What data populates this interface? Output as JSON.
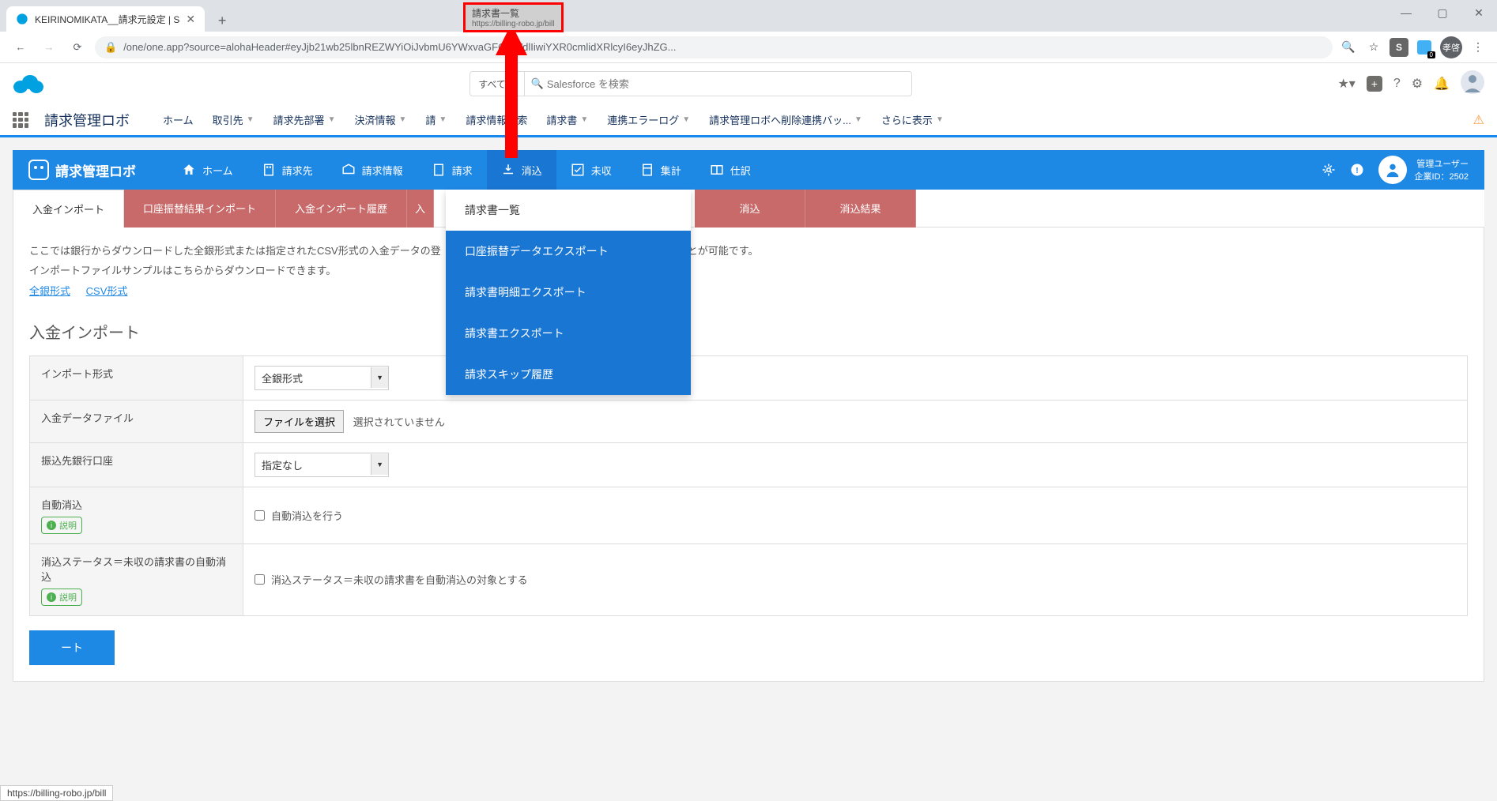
{
  "browser": {
    "tab_title": "KEIRINOMIKATA__請求元設定 | S",
    "url_display": "/one/one.app?source=alohaHeader#eyJjb21wb25lbnREZWYiOiJvbmU6YWxvaGFQYWdlIiwiYXR0cmlidXRlcyI6eyJhZG...",
    "tooltip_title": "請求書一覧",
    "tooltip_url": "https://billing-robo.jp/bill",
    "ext_s": "S",
    "ext_badge": "0",
    "profile": "孝啓"
  },
  "sf": {
    "search_filter": "すべて",
    "search_placeholder": "Salesforce を検索",
    "app_name": "請求管理ロボ",
    "nav": [
      "ホーム",
      "取引先",
      "請求先部署",
      "決済情報",
      "請",
      "請求情報検索",
      "請求書",
      "連携エラーログ",
      "請求管理ロボへ削除連携バッ...",
      "さらに表示"
    ]
  },
  "blue": {
    "app_title": "請求管理ロボ",
    "items": [
      {
        "label": "ホーム",
        "icon": "home"
      },
      {
        "label": "請求先",
        "icon": "building"
      },
      {
        "label": "請求情報",
        "icon": "inbox"
      },
      {
        "label": "請求",
        "icon": "file"
      },
      {
        "label": "消込",
        "icon": "download",
        "active": true
      },
      {
        "label": "未収",
        "icon": "check"
      },
      {
        "label": "集計",
        "icon": "calc"
      },
      {
        "label": "仕訳",
        "icon": "layout"
      }
    ],
    "user_line1": "管理ユーザー",
    "user_line2": "企業ID：2502"
  },
  "dropdown": [
    "請求書一覧",
    "口座振替データエクスポート",
    "請求書明細エクスポート",
    "請求書エクスポート",
    "請求スキップ履歴"
  ],
  "tabs": [
    "入金インポート",
    "口座振替結果インポート",
    "入金インポート履歴",
    "入",
    "消込",
    "消込結果"
  ],
  "content": {
    "desc1": "ここでは銀行からダウンロードした全銀形式または指定されたCSV形式の入金データの登　　　　　　　　　　　　　　　　　　　　　　　　とが可能です。",
    "desc2": "インポートファイルサンプルはこちらからダウンロードできます。",
    "link1": "全銀形式",
    "link2": "CSV形式",
    "section_title": "入金インポート",
    "rows": {
      "r1_label": "インポート形式",
      "r1_value": "全銀形式",
      "r2_label": "入金データファイル",
      "r2_btn": "ファイルを選択",
      "r2_status": "選択されていません",
      "r3_label": "振込先銀行口座",
      "r3_value": "指定なし",
      "r4_label": "自動消込",
      "r4_badge": "説明",
      "r4_chk": "自動消込を行う",
      "r5_label": "消込ステータス＝未収の請求書の自動消込",
      "r5_badge": "説明",
      "r5_chk": "消込ステータス＝未収の請求書を自動消込の対象とする"
    },
    "submit": "ート"
  },
  "status_bar": "https://billing-robo.jp/bill"
}
